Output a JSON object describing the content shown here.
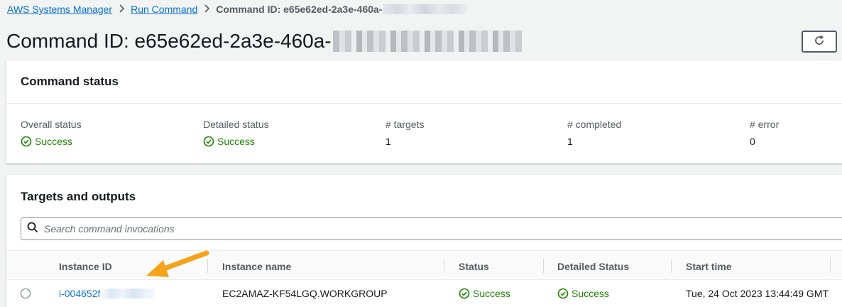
{
  "breadcrumb": {
    "items": [
      "AWS Systems Manager",
      "Run Command"
    ],
    "current": "Command ID: e65e62ed-2a3e-460a-"
  },
  "page": {
    "title": "Command ID: e65e62ed-2a3e-460a-"
  },
  "command_status": {
    "heading": "Command status",
    "stats": [
      {
        "label": "Overall status",
        "value": "Success"
      },
      {
        "label": "Detailed status",
        "value": "Success"
      },
      {
        "label": "# targets",
        "value": "1"
      },
      {
        "label": "# completed",
        "value": "1"
      },
      {
        "label": "# error",
        "value": "0"
      }
    ]
  },
  "targets": {
    "heading": "Targets and outputs",
    "search_placeholder": "Search command invocations",
    "columns": [
      "Instance ID",
      "Instance name",
      "Status",
      "Detailed Status",
      "Start time"
    ],
    "rows": [
      {
        "instance_id": "i-004652f",
        "instance_name": "EC2AMAZ-KF54LGQ.WORKGROUP",
        "status": "Success",
        "detailed_status": "Success",
        "start_time": "Tue, 24 Oct 2023 13:44:49 GMT"
      }
    ]
  },
  "colors": {
    "link": "#0972d3",
    "success": "#1d8102",
    "annotation_arrow": "#f5a31a"
  },
  "icons": [
    "chevron-right-icon",
    "refresh-icon",
    "check-circle-icon",
    "search-icon",
    "radio-button",
    "annotation-arrow"
  ]
}
